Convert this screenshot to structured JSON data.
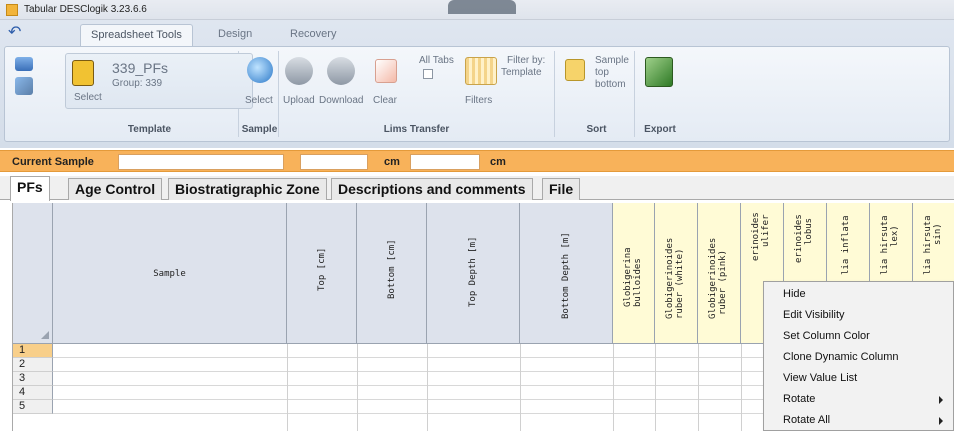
{
  "window": {
    "title": "Tabular DESClogik 3.23.6.6"
  },
  "ribbon": {
    "tabs": [
      {
        "label": "Spreadsheet Tools",
        "active": true
      },
      {
        "label": "Design",
        "active": false
      },
      {
        "label": "Recovery",
        "active": false
      }
    ],
    "template": {
      "name": "339_PFs",
      "group": "Group: 339",
      "select_label": "Select",
      "group_label": "Template"
    },
    "sample": {
      "select_label": "Select",
      "group_label": "Sample"
    },
    "lims": {
      "upload_label": "Upload",
      "download_label": "Download",
      "clear_label": "Clear",
      "all_tabs_label": "All Tabs",
      "filter_by_label": "Filter by:",
      "filter_by_value": "Template",
      "filters_label": "Filters",
      "group_label": "Lims Transfer"
    },
    "sort": {
      "line1": "Sample",
      "line2": "top",
      "line3": "bottom",
      "group_label": "Sort"
    },
    "export": {
      "group_label": "Export"
    }
  },
  "sample_bar": {
    "label": "Current Sample",
    "unit1": "cm",
    "unit2": "cm"
  },
  "data_tabs": [
    {
      "label": "PFs",
      "active": true
    },
    {
      "label": "Age Control",
      "active": false
    },
    {
      "label": "Biostratigraphic Zone",
      "active": false
    },
    {
      "label": "Descriptions and comments",
      "active": false
    },
    {
      "label": "File",
      "active": false
    }
  ],
  "grid": {
    "sample_header": "Sample",
    "columns": [
      "Top [cm]",
      "Bottom [cm]",
      "Top Depth [m]",
      "Bottom Depth [m]"
    ],
    "species_columns": [
      [
        "Globigerina",
        "bulloides"
      ],
      [
        "Globigerinoides",
        "ruber (white)"
      ],
      [
        "Globigerinoides",
        "ruber (pink)"
      ],
      [
        "erinoides",
        "ulifer"
      ],
      [
        "erinoides",
        "lobus"
      ],
      [
        "lia inflata",
        ""
      ],
      [
        "lia hirsuta",
        "lex)"
      ],
      [
        "lia hirsuta",
        "sin)"
      ]
    ],
    "rows": [
      "1",
      "2",
      "3",
      "4",
      "5"
    ]
  },
  "context_menu": {
    "items": [
      {
        "label": "Hide",
        "submenu": false
      },
      {
        "label": "Edit Visibility",
        "submenu": false
      },
      {
        "label": "Set Column Color",
        "submenu": false
      },
      {
        "label": "Clone Dynamic Column",
        "submenu": false
      },
      {
        "label": "View Value List",
        "submenu": false
      },
      {
        "label": "Rotate",
        "submenu": true
      },
      {
        "label": "Rotate All",
        "submenu": true
      }
    ]
  },
  "colors": {
    "sample_bar": "#f8b25a",
    "species_header": "#fffbd6",
    "header": "#dde2ec",
    "selected_row": "#f8cf8a"
  }
}
